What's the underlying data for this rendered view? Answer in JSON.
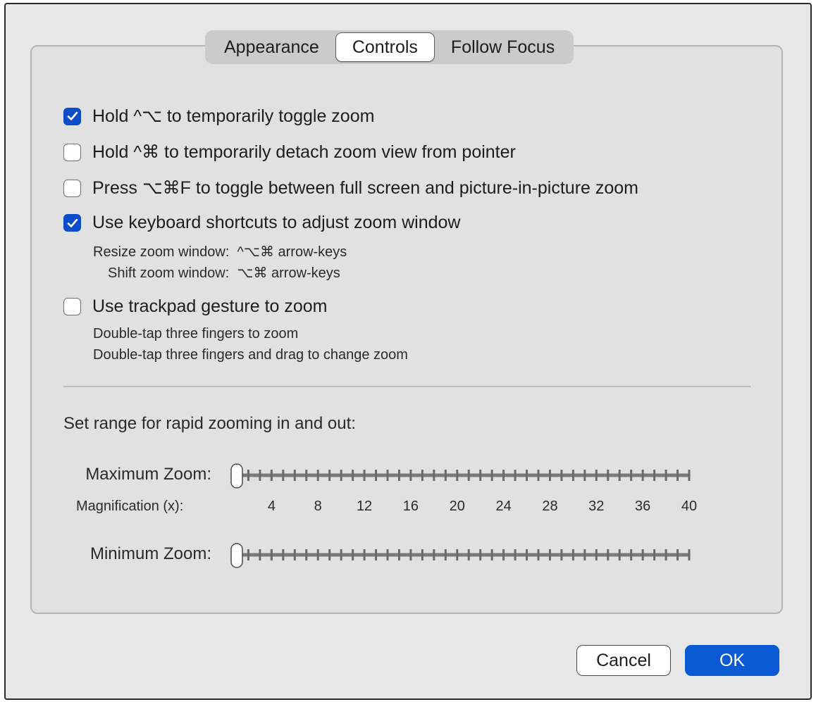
{
  "tabs": [
    {
      "label": "Appearance",
      "selected": false
    },
    {
      "label": "Controls",
      "selected": true
    },
    {
      "label": "Follow Focus",
      "selected": false
    }
  ],
  "options": {
    "toggle_zoom": {
      "label": "Hold ^⌥ to temporarily toggle zoom",
      "checked": true
    },
    "detach_zoom": {
      "label": "Hold ^⌘ to temporarily detach zoom view from pointer",
      "checked": false
    },
    "pip_toggle": {
      "label": "Press ⌥⌘F to toggle between full screen and picture-in-picture zoom",
      "checked": false
    },
    "keyboard_shortcuts": {
      "label": "Use keyboard shortcuts to adjust zoom window",
      "checked": true
    },
    "trackpad_gesture": {
      "label": "Use trackpad gesture to zoom",
      "checked": false
    }
  },
  "keyboard_help": {
    "resize": "Resize zoom window:  ^⌥⌘ arrow-keys",
    "shift": "Shift zoom window:  ⌥⌘ arrow-keys"
  },
  "trackpad_help": {
    "line1": "Double-tap three fingers to zoom",
    "line2": "Double-tap three fingers and drag to change zoom"
  },
  "range": {
    "heading": "Set range for rapid zooming in and out:",
    "max_label": "Maximum Zoom:",
    "min_label": "Minimum Zoom:",
    "magnification_label": "Magnification (x):",
    "ticks": [
      "4",
      "8",
      "12",
      "16",
      "20",
      "24",
      "28",
      "32",
      "36",
      "40"
    ],
    "max_value": 1,
    "min_value": 1,
    "scale_min": 1,
    "scale_max": 40
  },
  "buttons": {
    "cancel": "Cancel",
    "ok": "OK"
  },
  "colors": {
    "accent": "#0b4dc8",
    "ok_button": "#0a5ad4"
  },
  "icons": {
    "checkbox_checked": "checkmark-icon",
    "slider_knob": "slider-knob-icon"
  }
}
